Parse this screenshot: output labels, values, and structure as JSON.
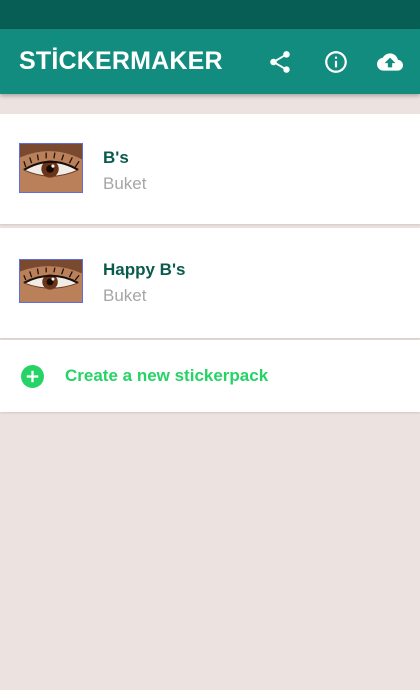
{
  "app": {
    "title": "STİCKERMAKER",
    "colors": {
      "status_bar": "#075e54",
      "app_bar": "#128c7e",
      "accent": "#25d366",
      "pack_name": "#0b5a4e",
      "background": "#ece3e0"
    }
  },
  "toolbar": {
    "actions": [
      {
        "icon": "share-icon"
      },
      {
        "icon": "info-icon"
      },
      {
        "icon": "cloud-upload-icon"
      }
    ]
  },
  "packs": [
    {
      "name": "B's",
      "author": "Buket",
      "thumbnail": "eye-image"
    },
    {
      "name": "Happy B's",
      "author": "Buket",
      "thumbnail": "eye-image"
    }
  ],
  "create": {
    "label": "Create a new stickerpack",
    "icon": "plus-circle-icon"
  }
}
